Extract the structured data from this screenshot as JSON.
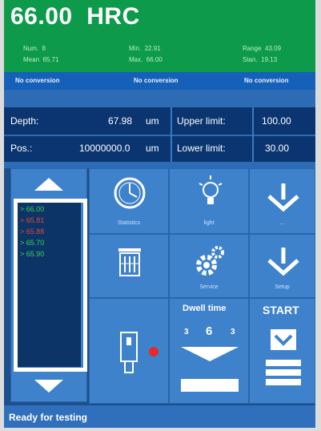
{
  "header": {
    "value": "66.00",
    "unit": "HRC",
    "stats": [
      {
        "label": "Num.",
        "value": "8"
      },
      {
        "label": "Mean",
        "value": "65.71"
      },
      {
        "label": "Min.",
        "value": "22.91"
      },
      {
        "label": "Max.",
        "value": "66.00"
      },
      {
        "label": "Range",
        "value": "43.09"
      },
      {
        "label": "Stan.",
        "value": "19.13"
      }
    ]
  },
  "conversions": [
    "No conversion",
    "No conversion",
    "No conversion"
  ],
  "depth": {
    "label": "Depth:",
    "value": "67.98",
    "unit": "um"
  },
  "position": {
    "label": "Pos.:",
    "value": "10000000.0",
    "unit": "um"
  },
  "limits": {
    "upper_label": "Upper limit:",
    "upper_value": "100.00",
    "lower_label": "Lower limit:",
    "lower_value": "30.00"
  },
  "results": [
    {
      "text": "> 66.00",
      "color": "#39d353"
    },
    {
      "text": "> 65.81",
      "color": "#e0473a"
    },
    {
      "text": "> 65.88",
      "color": "#e0473a"
    },
    {
      "text": "> 65.70",
      "color": "#39d353"
    },
    {
      "text": "> 65.90",
      "color": "#39d353"
    }
  ],
  "buttons": {
    "clock_label": "Statistics",
    "bulb_label": "light",
    "gears_label": "Service",
    "dwell_label": "Dwell time",
    "dwell_values": [
      "3",
      "6",
      "3"
    ],
    "start_label": "START",
    "download_label_1": "...",
    "download_label_2": "Setup"
  },
  "status": "Ready for testing",
  "colors": {
    "header": "#0d9a4a",
    "panel": "#1d4f8c",
    "tile": "#3f82cc",
    "record_dot": "#e8282c"
  }
}
